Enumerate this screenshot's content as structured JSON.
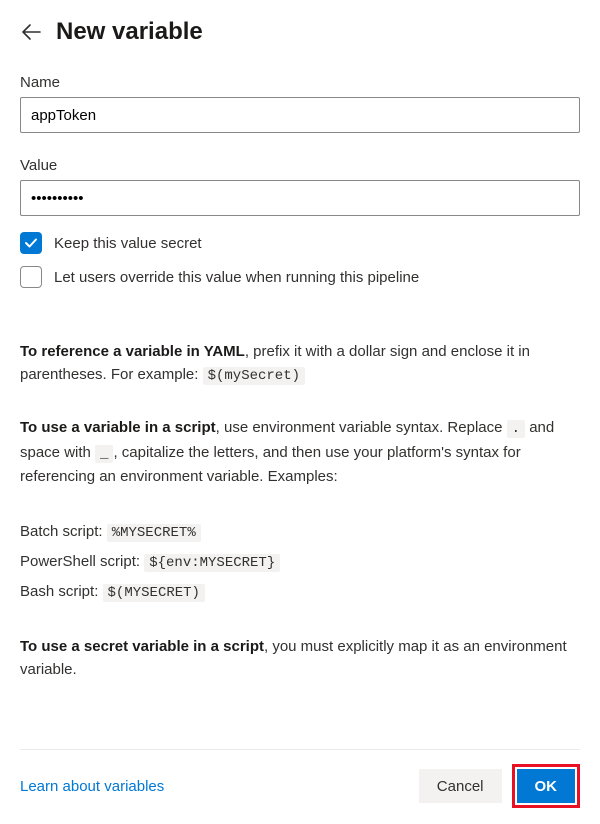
{
  "page_title": "New variable",
  "fields": {
    "name_label": "Name",
    "name_value": "appToken",
    "value_label": "Value",
    "value_value": "••••••••••"
  },
  "checkboxes": {
    "keep_secret": {
      "label": "Keep this value secret",
      "checked": true
    },
    "allow_override": {
      "label": "Let users override this value when running this pipeline",
      "checked": false
    }
  },
  "help": {
    "yaml_bold": "To reference a variable in YAML",
    "yaml_text": ", prefix it with a dollar sign and enclose it in parentheses. For example: ",
    "yaml_code": "$(mySecret)",
    "script_bold": "To use a variable in a script",
    "script_text1": ", use environment variable syntax. Replace ",
    "dot_code": ".",
    "script_text2": " and space with ",
    "us_code": "_",
    "script_text3": ", capitalize the letters, and then use your platform's syntax for referencing an environment variable. Examples:",
    "batch_label": "Batch script: ",
    "batch_code": "%MYSECRET%",
    "ps_label": "PowerShell script: ",
    "ps_code": "${env:MYSECRET}",
    "bash_label": "Bash script: ",
    "bash_code": "$(MYSECRET)",
    "secret_bold": "To use a secret variable in a script",
    "secret_text": ", you must explicitly map it as an environment variable."
  },
  "footer": {
    "learn_link": "Learn about variables",
    "cancel": "Cancel",
    "ok": "OK"
  }
}
